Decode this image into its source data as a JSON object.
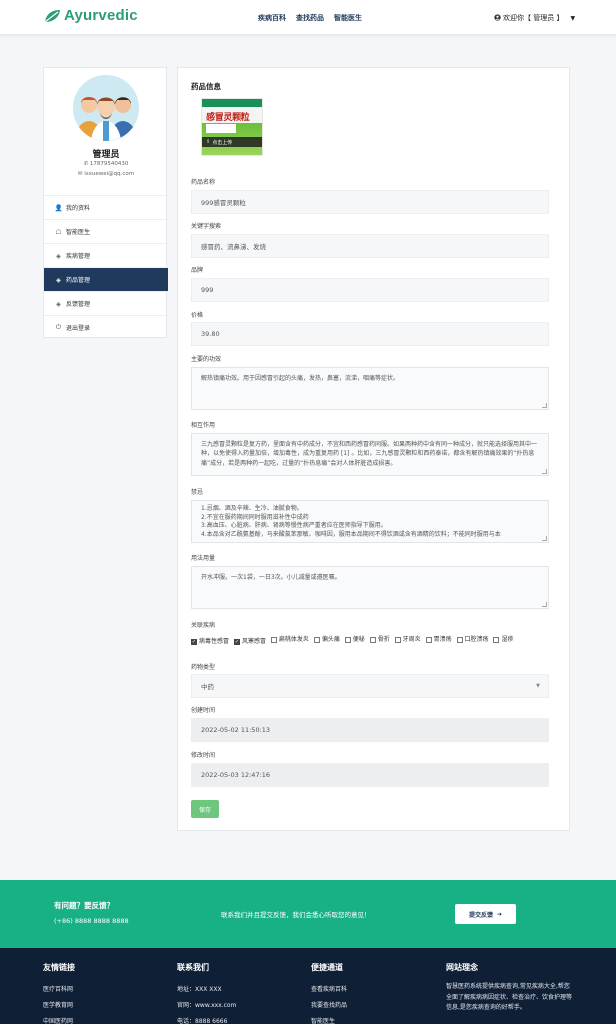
{
  "header": {
    "logo_text": "Ayurvedic",
    "nav": [
      "疾病百科",
      "查找药品",
      "智能医生"
    ],
    "user_label": "欢迎你【 管理员 】",
    "colors": {
      "brand": "#2e9e72",
      "nav": "#1f3a5c"
    }
  },
  "profile": {
    "name": "管理员",
    "phone": "17879540430",
    "email": "isxuewei@qq.com",
    "menu": [
      {
        "icon": "user-icon",
        "label": "我的资料"
      },
      {
        "icon": "doctor-icon",
        "label": "智能医生"
      },
      {
        "icon": "layers-icon",
        "label": "疾病管理"
      },
      {
        "icon": "layers-icon",
        "label": "药品管理",
        "active": true
      },
      {
        "icon": "layers-icon",
        "label": "反馈管理"
      },
      {
        "icon": "power-icon",
        "label": "退出登录"
      }
    ]
  },
  "drug": {
    "section_title": "药品信息",
    "image": {
      "box_title": "感冒灵颗粒",
      "upload_label": "点击上传"
    },
    "fields": {
      "name": {
        "label": "药品名称",
        "value": "999感冒灵颗粒"
      },
      "keywords": {
        "label": "关键字搜索",
        "value": "感冒药、流鼻涕、发烧"
      },
      "brand": {
        "label": "品牌",
        "value": "999"
      },
      "price": {
        "label": "价格",
        "value": "39.80"
      },
      "efficacy": {
        "label": "主要的功效",
        "value": "解热镇痛功效。用于因感冒引起的头痛，发热，鼻塞，流涕，咽痛等症状。"
      },
      "interaction": {
        "label": "相互作用",
        "value": "三九感冒灵颗粒是复方药，里面含有中药成分，不宜和西药感冒药同服。如果两种药中含有同一种成分，就只能选择服用其中一种，以免使得入药量加倍，增加毒性，成为重复用药 [1] 。比如，三九感冒灵颗粒和西药泰诺，都含有解热镇痛效果的“扑热息痛”成分，若是两种药一起吃，过量的“扑热息痛”会对人体肝脏造成损害。"
      },
      "taboo": {
        "label": "禁忌",
        "lines": [
          "1.忌烟、酒及辛辣、生冷、油腻食物。",
          "2.不宜在服药期间同时服用滋补性中成药",
          "3.高血压、心脏病、肝病、肾病等慢性病严重者应在医师指导下服用。",
          "4.本品含对乙酰氨基酚，马来酸氯苯那敏、咖啡因，服用本品期间不得饮酒或含有酒精的饮料；不能同时服用与本"
        ]
      },
      "usage": {
        "label": "用法用量",
        "value": "开水冲服。一次1袋，一日3次。小儿减量或遵医嘱。"
      },
      "diseases": {
        "label": "关联疾病",
        "options": [
          {
            "label": "病毒性感冒",
            "checked": true
          },
          {
            "label": "风寒感冒",
            "checked": true
          },
          {
            "label": "扁桃体发炎",
            "checked": false
          },
          {
            "label": "偏头痛",
            "checked": false
          },
          {
            "label": "便秘",
            "checked": false
          },
          {
            "label": "骨折",
            "checked": false
          },
          {
            "label": "牙周炎",
            "checked": false
          },
          {
            "label": "胃溃疡",
            "checked": false
          },
          {
            "label": "口腔溃疡",
            "checked": false
          },
          {
            "label": "湿疹",
            "checked": false
          }
        ]
      },
      "type": {
        "label": "药物类型",
        "value": "中药"
      },
      "created": {
        "label": "创建时间",
        "value": "2022-05-02 11:50:13"
      },
      "modified": {
        "label": "修改时间",
        "value": "2022-05-03 12:47:16"
      }
    },
    "save_label": "保存"
  },
  "cta": {
    "question": "有问题？要反馈？",
    "phone": "(+86) 8888 8888 8888",
    "text": "联系我们并且提交反馈，我们会悉心听取您的意见！",
    "button": "提交反馈",
    "color": "#18b085"
  },
  "footer": {
    "cols": [
      {
        "title": "友情链接",
        "links": [
          "医疗百科网",
          "医学教育网",
          "中国医药网"
        ]
      },
      {
        "title": "联系我们",
        "links": [
          "地址：XXX XXX",
          "官网：www.xxx.com",
          "电话：8888 6666"
        ]
      },
      {
        "title": "便捷通道",
        "links": [
          "查看疾病百科",
          "我要查找药品",
          "智能医生"
        ]
      }
    ],
    "idea": {
      "title": "网站理念",
      "text": "智慧医药系统提供疾病查询,常见疾病大全,帮您全面了解疾病病因症状、检查治疗、饮食护理等信息,是您疾病查询的好帮手。"
    },
    "color": "#0f1f36"
  }
}
